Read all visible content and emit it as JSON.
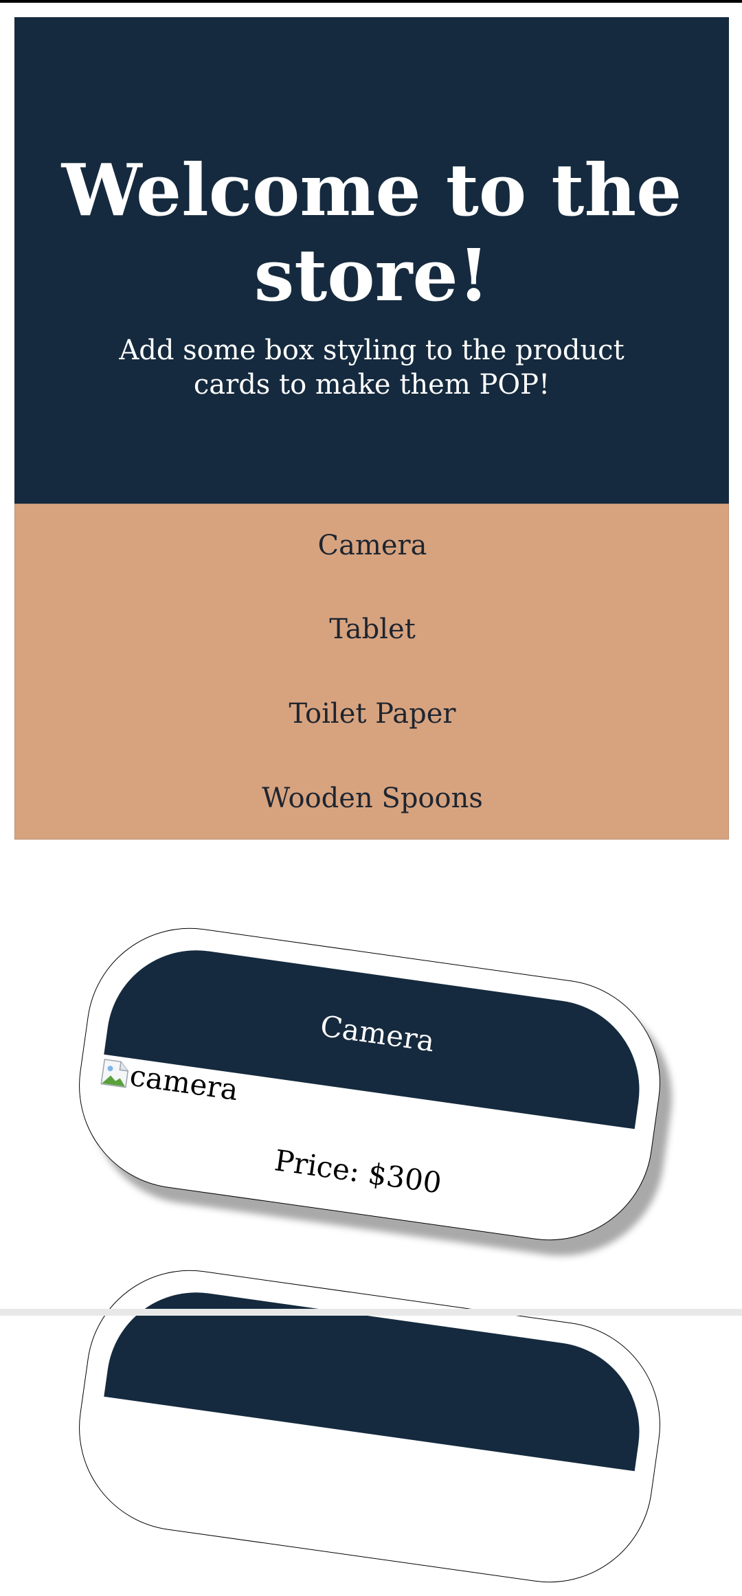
{
  "hero": {
    "title": "Welcome to the store!",
    "subtitle": "Add some box styling to the product cards to make them POP!"
  },
  "nav": {
    "items": [
      {
        "label": "Camera"
      },
      {
        "label": "Tablet"
      },
      {
        "label": "Toilet Paper"
      },
      {
        "label": "Wooden Spoons"
      }
    ]
  },
  "products": [
    {
      "name": "Camera",
      "image_alt": "camera",
      "price": "Price: $300"
    }
  ],
  "colors": {
    "hero_bg": "#152a3e",
    "nav_bg": "#d7a37f",
    "card_header_bg": "#152a3e"
  }
}
